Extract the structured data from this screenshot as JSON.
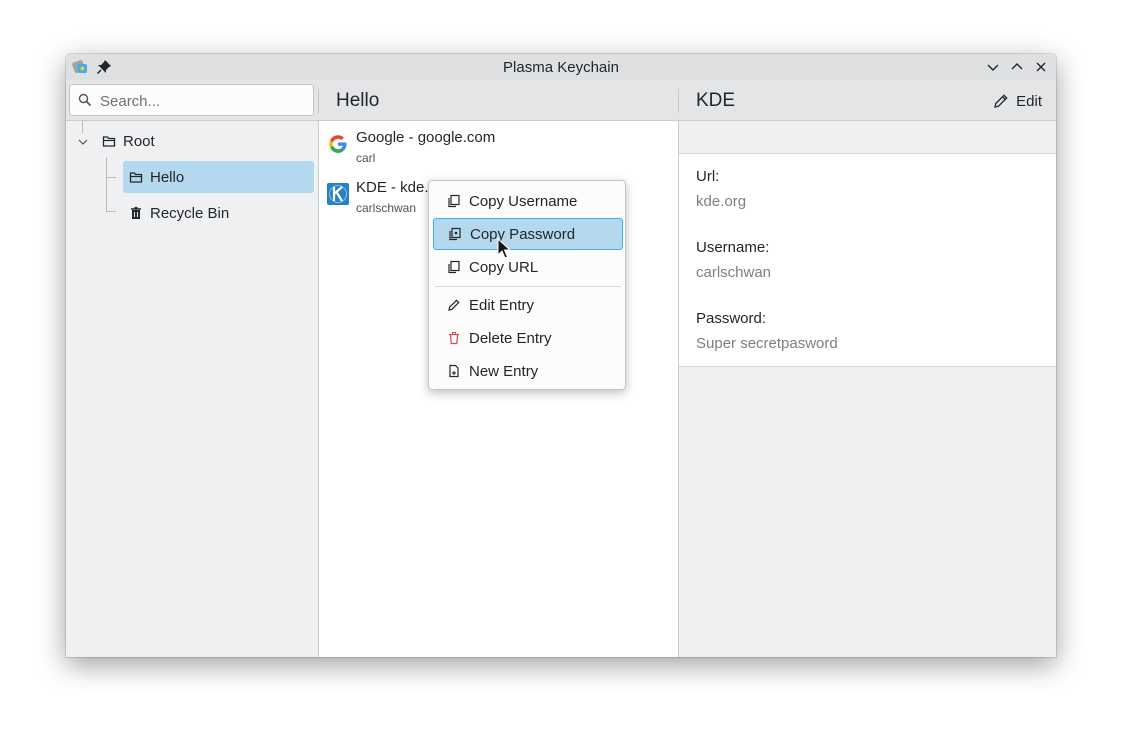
{
  "window": {
    "title": "Plasma Keychain"
  },
  "search": {
    "placeholder": "Search..."
  },
  "list_header": {
    "title": "Hello"
  },
  "detail_header": {
    "title": "KDE",
    "edit_label": "Edit"
  },
  "tree": {
    "root": "Root",
    "children": [
      "Hello",
      "Recycle Bin"
    ]
  },
  "entries": [
    {
      "title": "Google - google.com",
      "username": "carl",
      "icon": "google-icon"
    },
    {
      "title": "KDE - kde.",
      "username": "carlschwan",
      "icon": "kde-icon"
    }
  ],
  "details": {
    "url_label": "Url:",
    "url_value": "kde.org",
    "username_label": "Username:",
    "username_value": "carlschwan",
    "password_label": "Password:",
    "password_value": "Super secretpasword"
  },
  "context_menu": {
    "items": [
      {
        "label": "Copy Username",
        "icon": "copy-icon"
      },
      {
        "label": "Copy Password",
        "icon": "copy-password-icon"
      },
      {
        "label": "Copy URL",
        "icon": "copy-icon"
      },
      {
        "label": "Edit Entry",
        "icon": "pencil-icon"
      },
      {
        "label": "Delete Entry",
        "icon": "trash-icon"
      },
      {
        "label": "New Entry",
        "icon": "new-document-icon"
      }
    ],
    "highlighted_index": 1
  },
  "colors": {
    "selection": "#b4d9ef",
    "accent": "#3daee9",
    "delete_red": "#da4453"
  }
}
